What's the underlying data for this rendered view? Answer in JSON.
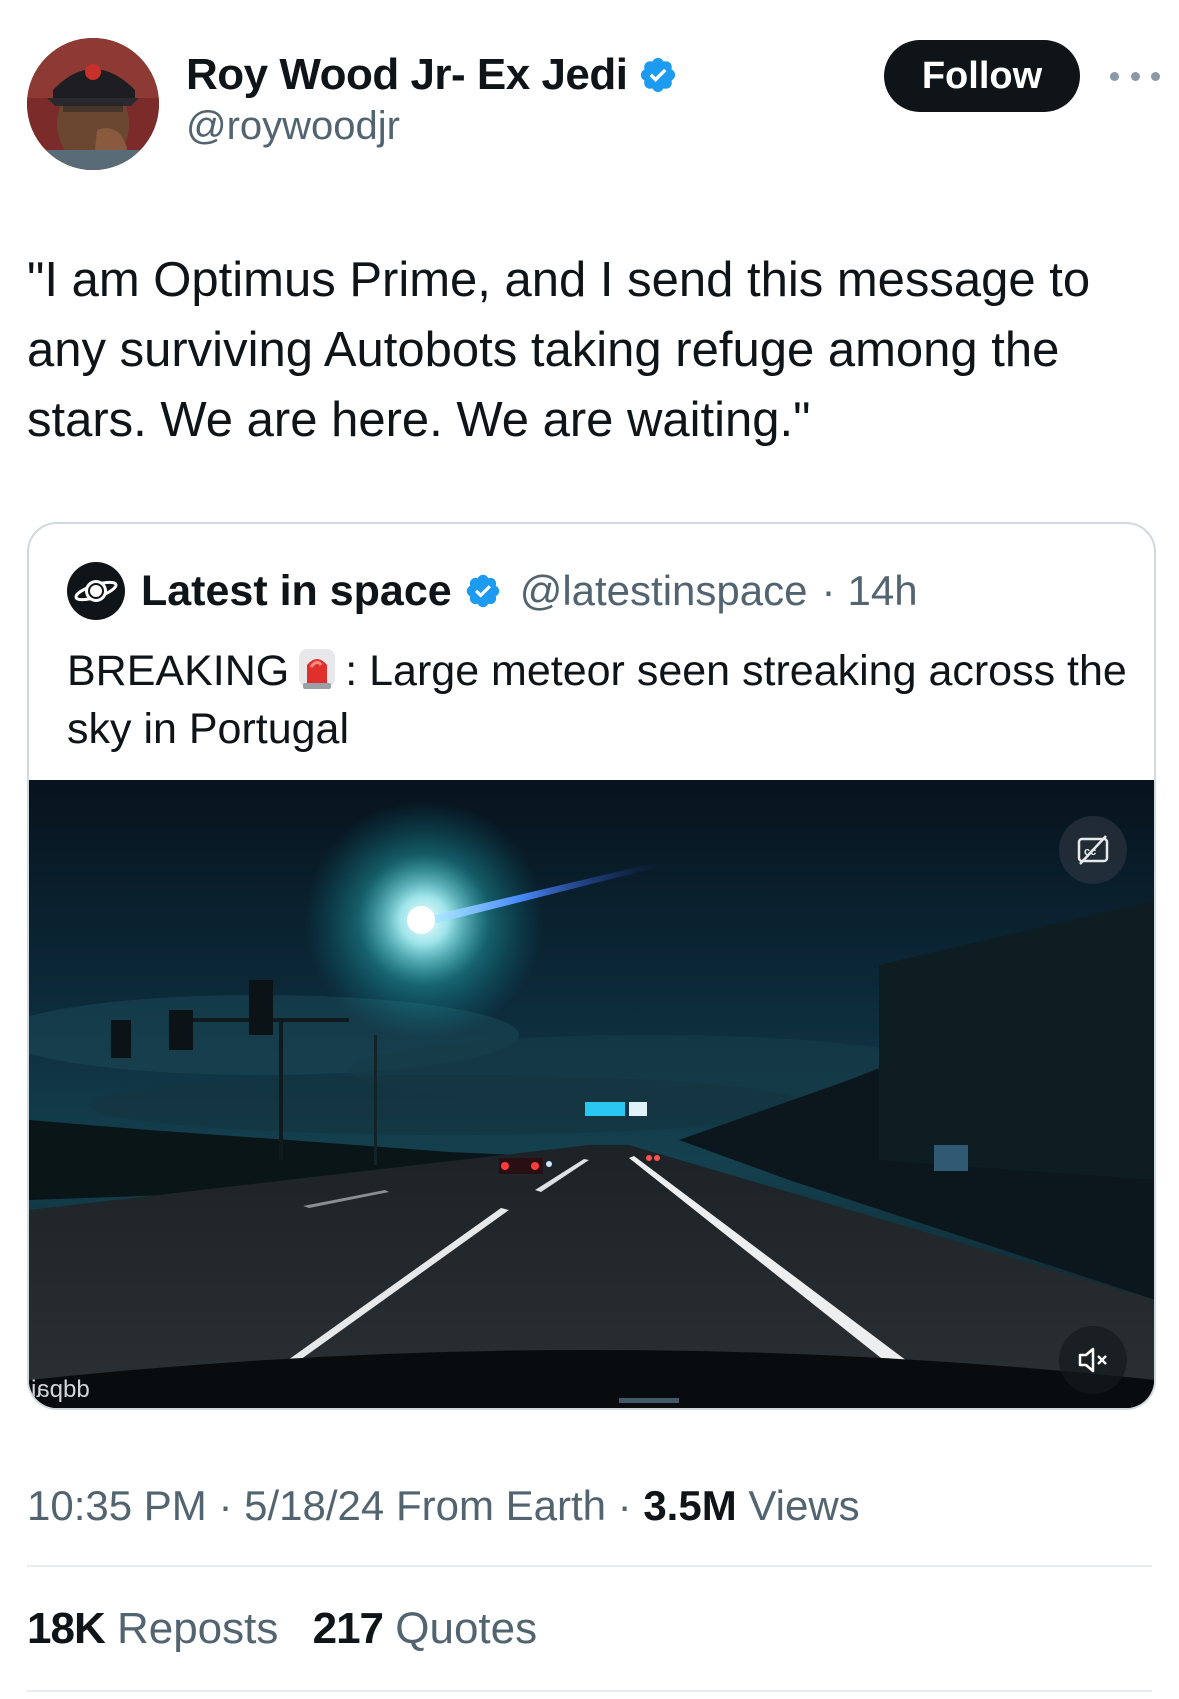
{
  "author": {
    "name": "Roy Wood Jr- Ex Jedi",
    "handle": "@roywoodjr",
    "verified": true
  },
  "follow_label": "Follow",
  "tweet_text": "\"I am Optimus Prime, and I send this message to any surviving Autobots taking refuge among the stars. We are here. We are waiting.\"",
  "quoted": {
    "name": "Latest in space",
    "handle": "@latestinspace",
    "separator": "·",
    "time": "14h",
    "text_before": "BREAKING",
    "text_after": ": Large meteor seen streaking across the sky in Portugal",
    "media_watermark": "ddpai"
  },
  "meta": {
    "time": "10:35 PM",
    "separator": "·",
    "date": "5/18/24",
    "source": "From Earth",
    "views_count": "3.5M",
    "views_label": "Views"
  },
  "stats": {
    "reposts_count": "18K",
    "reposts_label": "Reposts",
    "quotes_count": "217",
    "quotes_label": "Quotes"
  },
  "colors": {
    "verified": "#1d9bf0",
    "text": "#0f1419",
    "secondary": "#536471",
    "border": "#cfd9de"
  }
}
